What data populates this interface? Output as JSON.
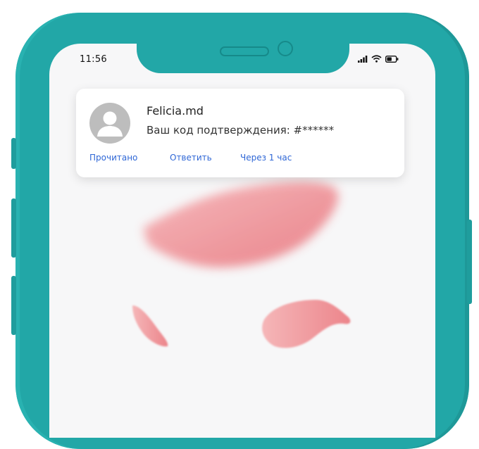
{
  "status_bar": {
    "time": "11:56",
    "icons": [
      "signal-icon",
      "wifi-icon",
      "battery-icon"
    ]
  },
  "notification": {
    "sender": "Felicia.md",
    "message": "Ваш код подтверждения: #******",
    "actions": [
      "Прочитано",
      "Ответить",
      "Через 1 час"
    ]
  },
  "colors": {
    "phone_frame": "#22a7a7",
    "screen": "#f7f7f8",
    "action_link": "#2f67d6",
    "petal": "#f08a8f"
  }
}
